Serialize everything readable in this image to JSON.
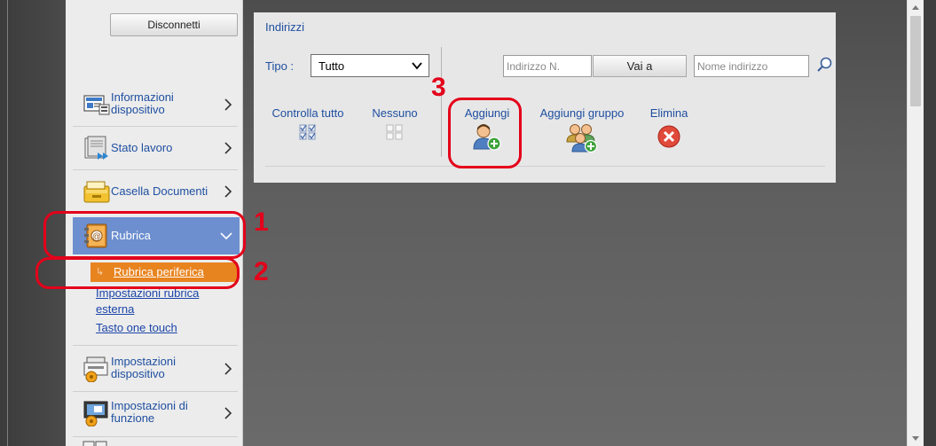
{
  "sidebar": {
    "disconnect_label": "Disconnetti",
    "items": [
      {
        "label": "Informazioni\ndispositivo",
        "icon": "device-info-icon"
      },
      {
        "label": "Stato lavoro",
        "icon": "job-status-icon"
      },
      {
        "label": "Casella Documenti",
        "icon": "document-box-icon"
      },
      {
        "label": "Rubrica",
        "icon": "address-book-icon",
        "expanded": true
      },
      {
        "label": "Impostazioni\ndispositivo",
        "icon": "device-settings-icon"
      },
      {
        "label": "Impostazioni di\nfunzione",
        "icon": "function-settings-icon"
      }
    ],
    "submenu": {
      "active": "Rubrica periferica",
      "links": [
        "Impostazioni rubrica esterna",
        "Tasto one touch"
      ],
      "link_line1": "Impostazioni rubrica",
      "link_line2": "esterna"
    }
  },
  "panel": {
    "title": "Indirizzi",
    "tipo_label": "Tipo :",
    "tipo_value": "Tutto",
    "number_placeholder": "Indirizzo N.",
    "go_label": "Vai a",
    "name_placeholder": "Nome indirizzo",
    "tools": {
      "check_all": "Controlla tutto",
      "none": "Nessuno",
      "add": "Aggiungi",
      "add_group": "Aggiungi gruppo",
      "delete": "Elimina"
    }
  },
  "annotations": {
    "step1": "1",
    "step2": "2",
    "step3": "3",
    "color": "#e4001a"
  },
  "colors": {
    "sidebar_active": "#6d8fcf",
    "submenu_active": "#e88420",
    "link": "#1f4fa0"
  }
}
